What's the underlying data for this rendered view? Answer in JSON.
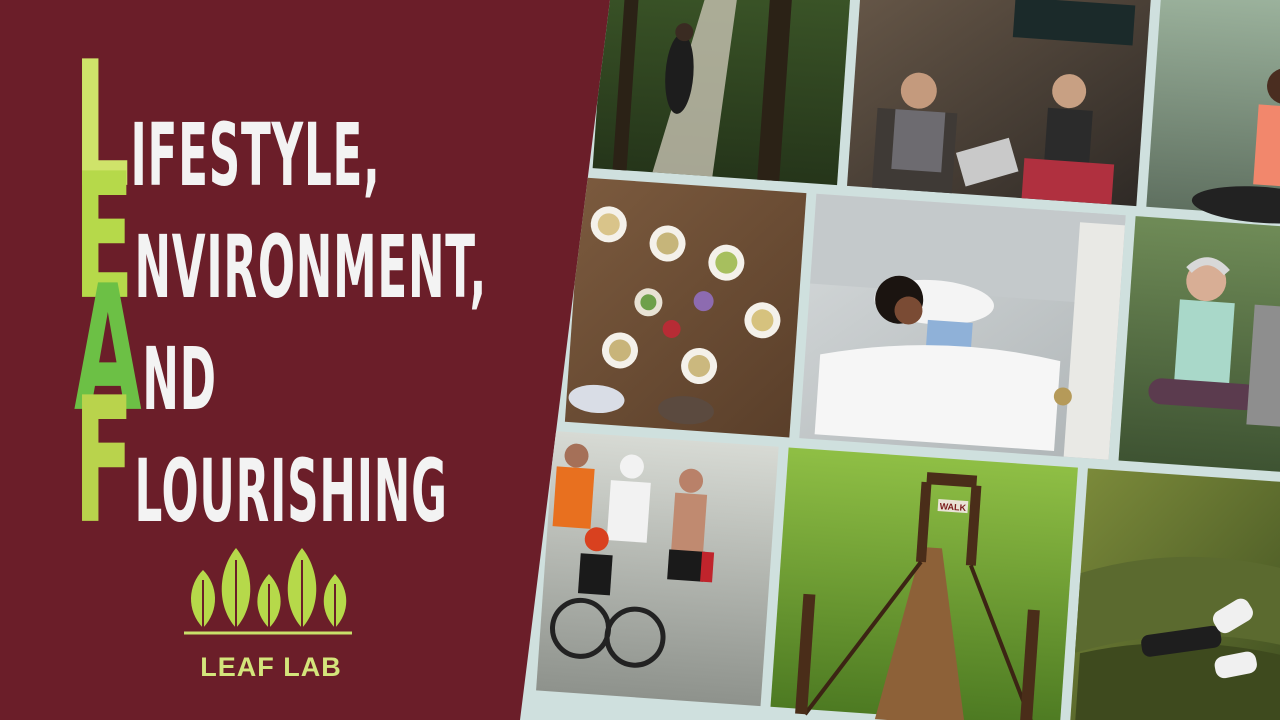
{
  "title": {
    "lines": [
      {
        "cap": "L",
        "rest": "IFESTYLE,"
      },
      {
        "cap": "E",
        "rest": "NVIRONMENT,"
      },
      {
        "cap": "A",
        "rest": "ND"
      },
      {
        "cap": "F",
        "rest": "LOURISHING"
      }
    ]
  },
  "brand": {
    "name": "LEAF LAB"
  },
  "colors": {
    "background": "#6b1e29",
    "title_text": "#f3f3f3",
    "accent_green": "#b6d94a",
    "photo_border": "#cfe0de"
  },
  "photos": [
    "forest-hiking-photo",
    "coworking-cafe-photo",
    "meditation-photo",
    "shared-meal-table-photo",
    "sleeping-woman-bed-photo",
    "older-adults-yoga-mat-photo",
    "marathon-runners-photo",
    "suspension-bridge-forest-photo",
    "hammock-relaxing-photo"
  ],
  "collage_sign": "WALK"
}
